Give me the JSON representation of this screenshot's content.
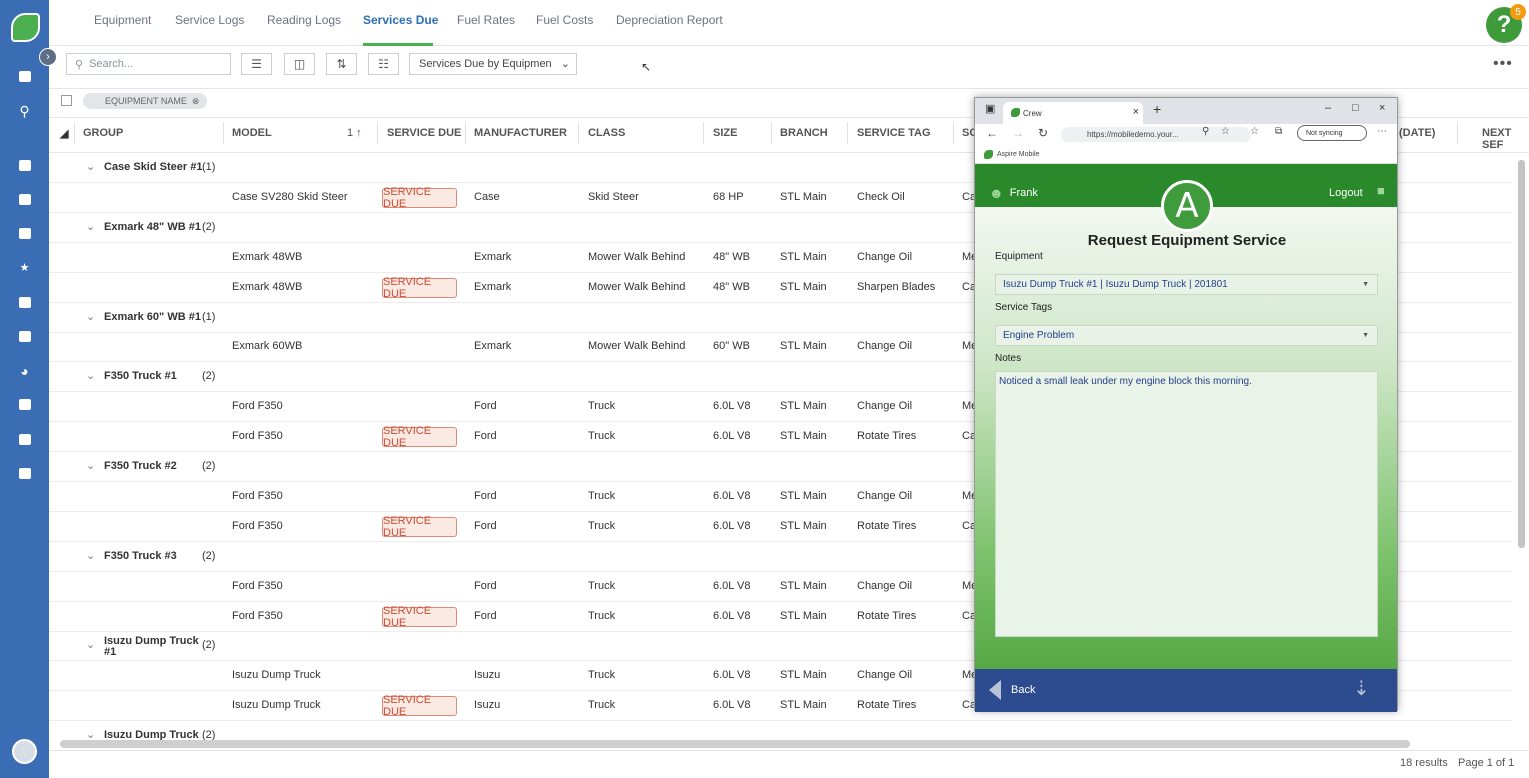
{
  "tabs": [
    {
      "label": "Equipment"
    },
    {
      "label": "Service Logs"
    },
    {
      "label": "Reading Logs"
    },
    {
      "label": "Services Due"
    },
    {
      "label": "Fuel Rates"
    },
    {
      "label": "Fuel Costs"
    },
    {
      "label": "Depreciation Report"
    }
  ],
  "help": {
    "badge": "5"
  },
  "toolbar": {
    "search_placeholder": "Search...",
    "view_select": "Services Due by Equipmen"
  },
  "chip": {
    "label": "EQUIPMENT NAME"
  },
  "headers": {
    "group": "GROUP",
    "model": "MODEL",
    "sort": "1 ↑",
    "service_due": "SERVICE DUE",
    "manufacturer": "MANUFACTURER",
    "class": "CLASS",
    "size": "SIZE",
    "branch": "BRANCH",
    "service_tag": "SERVICE TAG",
    "sc": "SC",
    "date": "(DATE)",
    "next": "NEXT SEF"
  },
  "badge_label": "SERVICE DUE",
  "groups": [
    {
      "name": "Case Skid Steer #1",
      "count": "(1)",
      "rows": [
        {
          "model": "Case SV280 Skid Steer",
          "due": true,
          "manufacturer": "Case",
          "class": "Skid Steer",
          "size": "68 HP",
          "branch": "STL Main",
          "tag": "Check Oil",
          "sc": "Ca"
        }
      ]
    },
    {
      "name": "Exmark 48\" WB #1",
      "count": "(2)",
      "rows": [
        {
          "model": "Exmark 48WB",
          "due": false,
          "manufacturer": "Exmark",
          "class": "Mower Walk Behind",
          "size": "48\" WB",
          "branch": "STL Main",
          "tag": "Change Oil",
          "sc": "Me"
        },
        {
          "model": "Exmark 48WB",
          "due": true,
          "manufacturer": "Exmark",
          "class": "Mower Walk Behind",
          "size": "48\" WB",
          "branch": "STL Main",
          "tag": "Sharpen Blades",
          "sc": "Ca"
        }
      ]
    },
    {
      "name": "Exmark 60\" WB #1",
      "count": "(1)",
      "rows": [
        {
          "model": "Exmark 60WB",
          "due": false,
          "manufacturer": "Exmark",
          "class": "Mower Walk Behind",
          "size": "60\" WB",
          "branch": "STL Main",
          "tag": "Change Oil",
          "sc": "Me"
        }
      ]
    },
    {
      "name": "F350 Truck #1",
      "count": "(2)",
      "rows": [
        {
          "model": "Ford F350",
          "due": false,
          "manufacturer": "Ford",
          "class": "Truck",
          "size": "6.0L V8",
          "branch": "STL Main",
          "tag": "Change Oil",
          "sc": "Me"
        },
        {
          "model": "Ford F350",
          "due": true,
          "manufacturer": "Ford",
          "class": "Truck",
          "size": "6.0L V8",
          "branch": "STL Main",
          "tag": "Rotate Tires",
          "sc": "Ca"
        }
      ]
    },
    {
      "name": "F350 Truck #2",
      "count": "(2)",
      "rows": [
        {
          "model": "Ford F350",
          "due": false,
          "manufacturer": "Ford",
          "class": "Truck",
          "size": "6.0L V8",
          "branch": "STL Main",
          "tag": "Change Oil",
          "sc": "Me"
        },
        {
          "model": "Ford F350",
          "due": true,
          "manufacturer": "Ford",
          "class": "Truck",
          "size": "6.0L V8",
          "branch": "STL Main",
          "tag": "Rotate Tires",
          "sc": "Ca"
        }
      ]
    },
    {
      "name": "F350 Truck #3",
      "count": "(2)",
      "rows": [
        {
          "model": "Ford F350",
          "due": false,
          "manufacturer": "Ford",
          "class": "Truck",
          "size": "6.0L V8",
          "branch": "STL Main",
          "tag": "Change Oil",
          "sc": "Me"
        },
        {
          "model": "Ford F350",
          "due": true,
          "manufacturer": "Ford",
          "class": "Truck",
          "size": "6.0L V8",
          "branch": "STL Main",
          "tag": "Rotate Tires",
          "sc": "Ca"
        }
      ]
    },
    {
      "name": "Isuzu Dump Truck #1",
      "count": "(2)",
      "rows": [
        {
          "model": "Isuzu Dump Truck",
          "due": false,
          "manufacturer": "Isuzu",
          "class": "Truck",
          "size": "6.0L V8",
          "branch": "STL Main",
          "tag": "Change Oil",
          "sc": "Me"
        },
        {
          "model": "Isuzu Dump Truck",
          "due": true,
          "manufacturer": "Isuzu",
          "class": "Truck",
          "size": "6.0L V8",
          "branch": "STL Main",
          "tag": "Rotate Tires",
          "sc": "Ca"
        }
      ]
    },
    {
      "name": "Isuzu Dump Truck",
      "count": "(2)",
      "rows": []
    }
  ],
  "footer": {
    "results": "18 results",
    "page": "Page  1  of  1"
  },
  "browser": {
    "tab_title": "Crew",
    "url": "https://mobiledemo.your...",
    "sync": "Not syncing",
    "favorite": "Aspire Mobile"
  },
  "mobile": {
    "user": "Frank",
    "logout": "Logout",
    "logo_letter": "A",
    "title": "Request Equipment Service",
    "equipment_label": "Equipment",
    "equipment_value": "Isuzu Dump Truck #1 | Isuzu Dump Truck | 201801",
    "tags_label": "Service Tags",
    "tags_value": "Engine Problem",
    "notes_label": "Notes",
    "notes_value": "Noticed a small leak under my engine block this morning.",
    "back": "Back"
  }
}
